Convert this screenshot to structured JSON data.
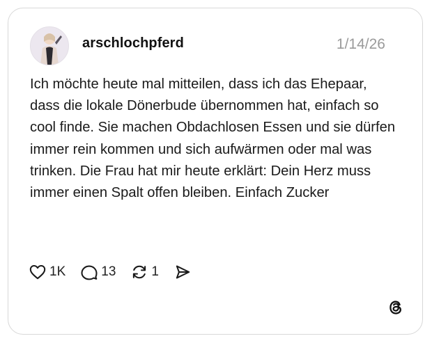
{
  "post": {
    "username": "arschlochpferd",
    "date": "1/14/26",
    "text": "Ich möchte heute mal mitteilen, dass ich das Ehepaar, dass die lokale Dönerbude übernommen hat, einfach so cool finde. Sie machen Obdachlosen Essen und sie dürfen immer rein kommen und sich aufwärmen oder mal was trinken. Die Frau hat mir heute erklärt: Dein Herz muss immer einen Spalt offen bleiben. Einfach Zucker"
  },
  "actions": {
    "like": {
      "icon": "heart-icon",
      "count": "1K"
    },
    "reply": {
      "icon": "comment-icon",
      "count": "13"
    },
    "repost": {
      "icon": "repost-icon",
      "count": "1"
    },
    "share": {
      "icon": "send-icon"
    }
  },
  "branding": {
    "icon": "threads-logo-icon"
  },
  "colors": {
    "text": "#1a1a1a",
    "muted": "#9a9a9a",
    "border": "#d8d8d8"
  }
}
